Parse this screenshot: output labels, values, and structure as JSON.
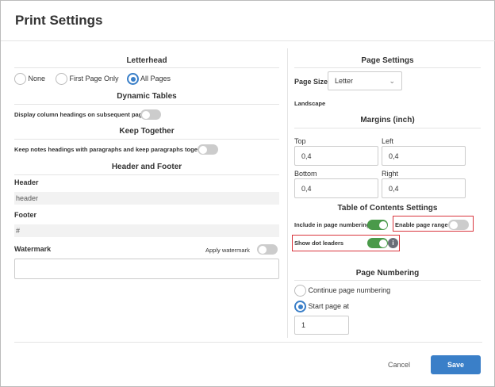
{
  "title": "Print Settings",
  "left": {
    "letterhead": {
      "heading": "Letterhead",
      "options": [
        "None",
        "First Page Only",
        "All Pages"
      ],
      "selected": "All Pages"
    },
    "dynamic_tables": {
      "heading": "Dynamic Tables",
      "toggle_label": "Display column headings on subsequent pages",
      "on": false
    },
    "keep_together": {
      "heading": "Keep Together",
      "toggle_label": "Keep notes headings with paragraphs and keep paragraphs together",
      "on": false
    },
    "header_footer": {
      "heading": "Header and Footer",
      "header_label": "Header",
      "header_value": "header",
      "footer_label": "Footer",
      "footer_value": "#"
    },
    "watermark": {
      "label": "Watermark",
      "apply_label": "Apply watermark",
      "on": false,
      "value": ""
    }
  },
  "right": {
    "page_settings": {
      "heading": "Page Settings",
      "page_size_label": "Page Size",
      "page_size_value": "Letter",
      "orientation": "Landscape"
    },
    "margins": {
      "heading": "Margins (inch)",
      "top_label": "Top",
      "top": "0,4",
      "left_label": "Left",
      "left": "0,4",
      "bottom_label": "Bottom",
      "bottom": "0,4",
      "right_label": "Right",
      "right": "0,4"
    },
    "toc": {
      "heading": "Table of Contents Settings",
      "include_label": "Include in page numbering",
      "include_on": true,
      "range_label": "Enable page range",
      "range_on": false,
      "dots_label": "Show dot leaders",
      "dots_on": true
    },
    "page_numbering": {
      "heading": "Page Numbering",
      "continue_label": "Continue page numbering",
      "start_label": "Start page at",
      "selected": "Start page at",
      "start_value": "1"
    }
  },
  "footer": {
    "cancel": "Cancel",
    "save": "Save"
  },
  "colors": {
    "accent": "#3a7fc8",
    "toggle_on": "#4a9a4a",
    "highlight": "#d9363e"
  }
}
